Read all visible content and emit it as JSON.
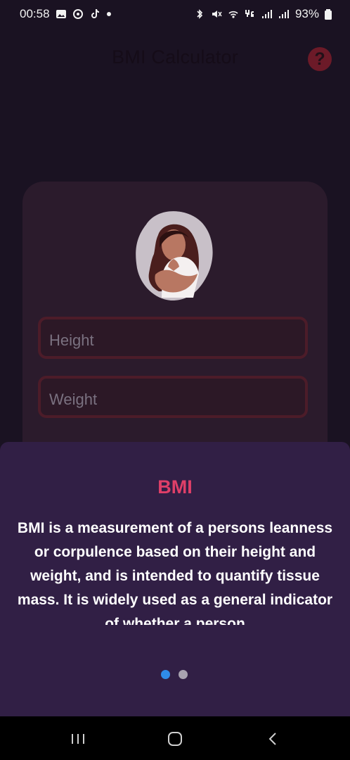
{
  "statusbar": {
    "time": "00:58",
    "left_icons": [
      "image-icon",
      "gallery-icon",
      "tiktok-icon",
      "dot-icon"
    ],
    "right_icons": [
      "bluetooth-icon",
      "mute-icon",
      "wifi-icon",
      "4g-icon",
      "signal-icon",
      "signal-icon"
    ],
    "battery": "93%"
  },
  "header": {
    "title": "BMI Calculator",
    "help_label": "?"
  },
  "form": {
    "height_placeholder": "Height",
    "weight_placeholder": "Weight"
  },
  "sheet": {
    "title": "BMI",
    "text": "BMI is a measurement of a persons leanness or corpulence based on their height and weight, and is intended to quantify tissue mass. It is widely used as a general indicator of whether a person"
  },
  "pager": {
    "active_index": 0,
    "count": 2
  },
  "navbar": {
    "items": [
      "recent-apps",
      "home",
      "back"
    ]
  },
  "colors": {
    "background": "#1a1222",
    "card": "#2b1b2c",
    "sheet": "#311f45",
    "accent": "#df3f68",
    "active_dot": "#2f8be9"
  }
}
